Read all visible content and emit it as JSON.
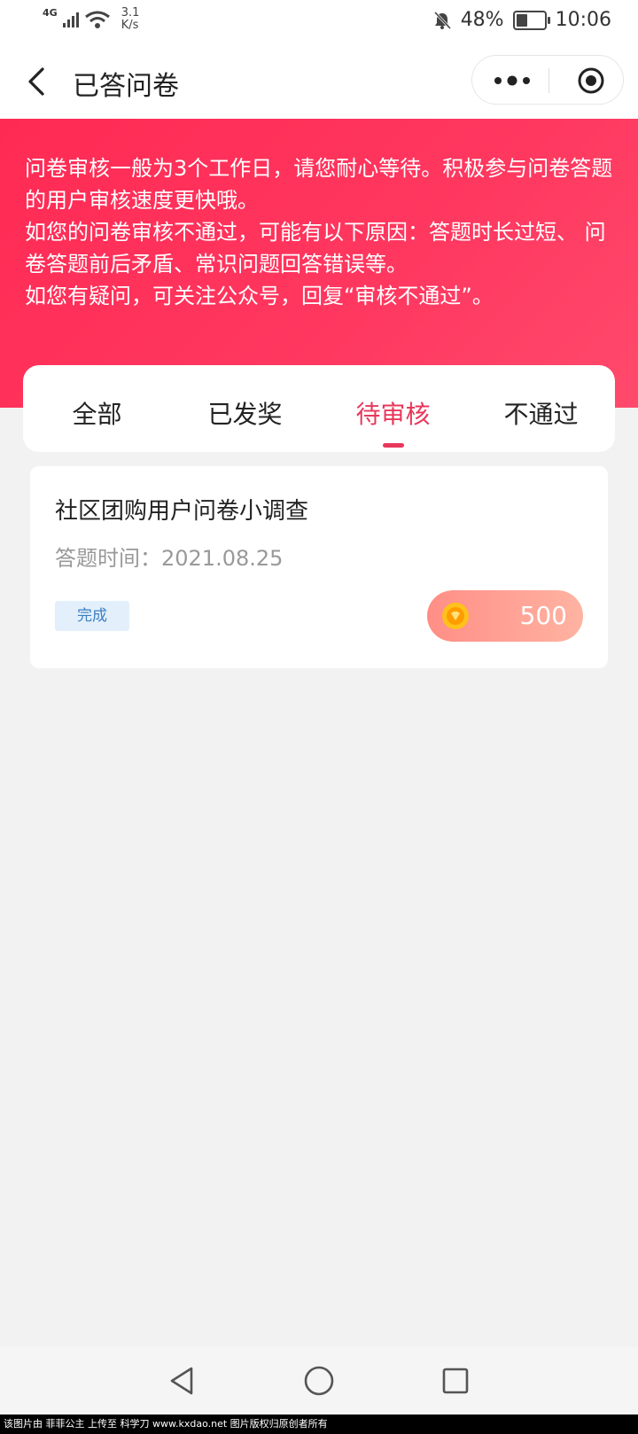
{
  "status_bar": {
    "network_type": "4G",
    "speed_value": "3.1",
    "speed_unit": "K/s",
    "battery_percent": "48%",
    "battery_level": 0.48,
    "time": "10:06",
    "icons": [
      "signal-icon",
      "wifi-icon",
      "mute-bell-icon",
      "battery-icon"
    ]
  },
  "nav": {
    "title": "已答问卷",
    "back_icon": "chevron-left-icon",
    "more_icon": "more-dots-icon",
    "close_icon": "target-icon"
  },
  "notice": {
    "lines": [
      "问卷审核一般为3个工作日，请您耐心等待。积极参与问卷答题的用户审核速度更快哦。",
      "如您的问卷审核不通过，可能有以下原因：答题时长过短、 问卷答题前后矛盾、常识问题回答错误等。",
      "如您有疑问，可关注公众号，回复“审核不通过”。"
    ],
    "banner_color": "#ff2f58"
  },
  "tabs": [
    {
      "label": "全部",
      "active": false
    },
    {
      "label": "已发奖",
      "active": false
    },
    {
      "label": "待审核",
      "active": true
    },
    {
      "label": "不通过",
      "active": false
    }
  ],
  "accent_color": "#e8385c",
  "survey": {
    "title": "社区团购用户问卷小调查",
    "time_label": "答题时间：2021.08.25",
    "status": "完成",
    "reward": "500",
    "reward_icon": "coin-icon"
  },
  "system_nav": {
    "back_icon": "triangle-back-icon",
    "home_icon": "circle-home-icon",
    "recents_icon": "square-recents-icon"
  },
  "footer": {
    "text": "该图片由 菲菲公主 上传至 科学刀 www.kxdao.net 图片版权归原创者所有"
  }
}
